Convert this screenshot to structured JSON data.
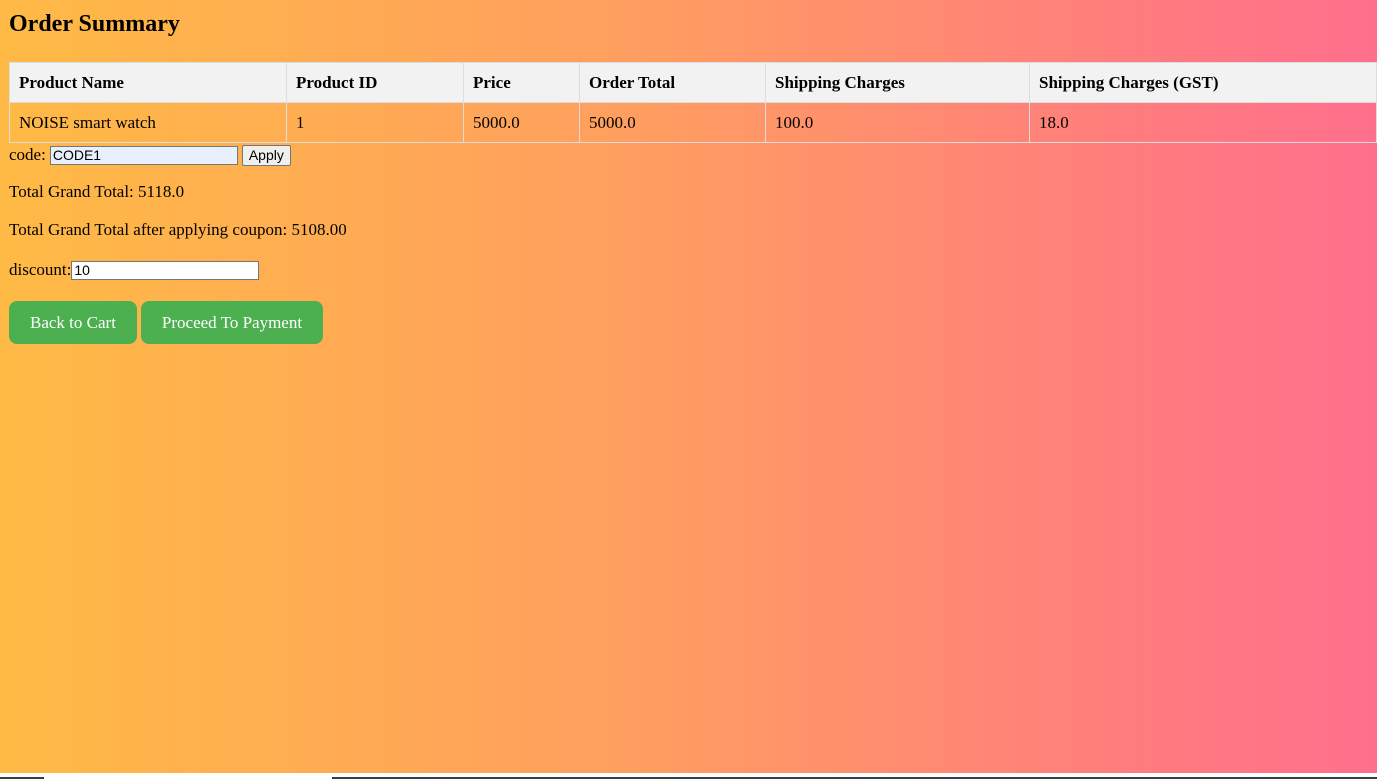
{
  "page": {
    "title": "Order Summary"
  },
  "table": {
    "headers": [
      "Product Name",
      "Product ID",
      "Price",
      "Order Total",
      "Shipping Charges",
      "Shipping Charges (GST)"
    ],
    "rows": [
      [
        "NOISE smart watch",
        "1",
        "5000.0",
        "5000.0",
        "100.0",
        "18.0"
      ]
    ]
  },
  "coupon": {
    "label": "code:",
    "value": "CODE1",
    "apply_label": "Apply"
  },
  "totals": {
    "grand_total_text": "Total Grand Total: 5118.0",
    "after_coupon_text": "Total Grand Total after applying coupon: 5108.00"
  },
  "discount": {
    "label": "discount:",
    "value": "10"
  },
  "actions": {
    "back_label": "Back to Cart",
    "proceed_label": "Proceed To Payment"
  },
  "colors": {
    "gradient_start": "#ffba45",
    "gradient_end": "#ff6f8d",
    "button_green": "#4caf50",
    "header_bg": "#f2f2f2"
  }
}
